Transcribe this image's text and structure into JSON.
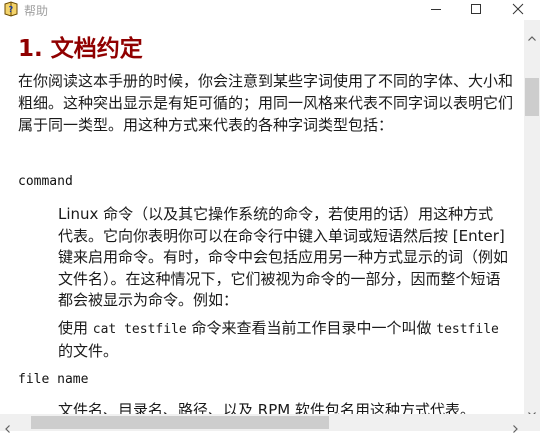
{
  "window": {
    "title": "帮助",
    "icons": {
      "app": "help-book-icon",
      "minimize": "minimize-icon",
      "maximize": "maximize-icon",
      "close": "close-icon"
    }
  },
  "doc": {
    "heading": "1. 文档约定",
    "intro": "在你阅读这本手册的时候，你会注意到某些字词使用了不同的字体、大小和粗细。这种突出显示是有矩可循的；用同一风格来代表不同字词以表明它们属于同一类型。用这种方式来代表的各种字词类型包括：",
    "terms": [
      {
        "term": "command",
        "description": "Linux 命令（以及其它操作系统的命令，若使用的话）用这种方式代表。它向你表明你可以在命令行中键入单词或短语然后按 [Enter] 键来启用命令。有时，命令中会包括应用另一种方式显示的词（例如文件名）。在这种情况下，它们被视为命令的一部分，因而整个短语都会被显示为命令。例如：",
        "example": {
          "prefix": "使用 ",
          "code1": "cat testfile",
          "middle": " 命令来查看当前工作目录中一个叫做 ",
          "code2": "testfile",
          "suffix": " 的文件。"
        }
      },
      {
        "term": "file name",
        "description": "文件名、目录名、路径、以及 RPM 软件包名用这种方式代表。"
      }
    ]
  },
  "scrollbars": {
    "vertical_arrows": [
      "scroll-up-arrow-icon",
      "scroll-down-arrow-icon"
    ],
    "horizontal_arrows": [
      "scroll-left-arrow-icon",
      "scroll-right-arrow-icon"
    ]
  }
}
